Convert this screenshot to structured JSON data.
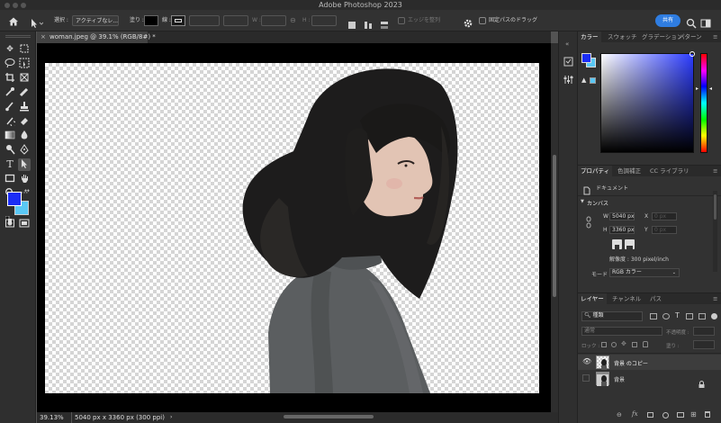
{
  "app": {
    "title": "Adobe Photoshop 2023",
    "share_label": "共有"
  },
  "options_bar": {
    "select_label": "選択 :",
    "select_value": "アクティブなレ...",
    "fill_label": "塗り :",
    "stroke_label": "線 :",
    "w_label": "W :",
    "h_label": "H :",
    "align_edges": "エッジを整列",
    "fixed_path_drag": "固定パスのドラッグ"
  },
  "document": {
    "tab_title": "woman.jpeg @ 39.1% (RGB/8#) *",
    "zoom": "39.13%",
    "dimensions_info": "5040 px x 3360 px (300 ppi)"
  },
  "color_panel": {
    "tabs": [
      "カラー",
      "スウォッチ",
      "グラデーション",
      "パターン"
    ],
    "foreground": "#1b2df5",
    "background": "#5ac8f5",
    "hue_color": "#2c3cff"
  },
  "properties_panel": {
    "tabs": [
      "プロパティ",
      "色調補正",
      "CC ライブラリ"
    ],
    "doc_label": "ドキュメント",
    "canvas_header": "カンバス",
    "w_label": "W",
    "w_value": "5040 px",
    "h_label": "H",
    "h_value": "3360 px",
    "x_label": "X",
    "x_placeholder": "0 px",
    "y_label": "Y",
    "y_placeholder": "0 px",
    "resolution": "解像度 : 300 pixel/inch",
    "mode_label": "モード",
    "mode_value": "RGB カラー"
  },
  "layers_panel": {
    "tabs": [
      "レイヤー",
      "チャンネル",
      "パス"
    ],
    "filter_value": "種類",
    "blend_mode": "通常",
    "opacity_label": "不透明度 :",
    "lock_label": "ロック :",
    "fill_label": "塗り :",
    "layers": [
      {
        "name": "背景 のコピー",
        "visible": true,
        "locked": false
      },
      {
        "name": "背景",
        "visible": false,
        "locked": true
      }
    ]
  }
}
